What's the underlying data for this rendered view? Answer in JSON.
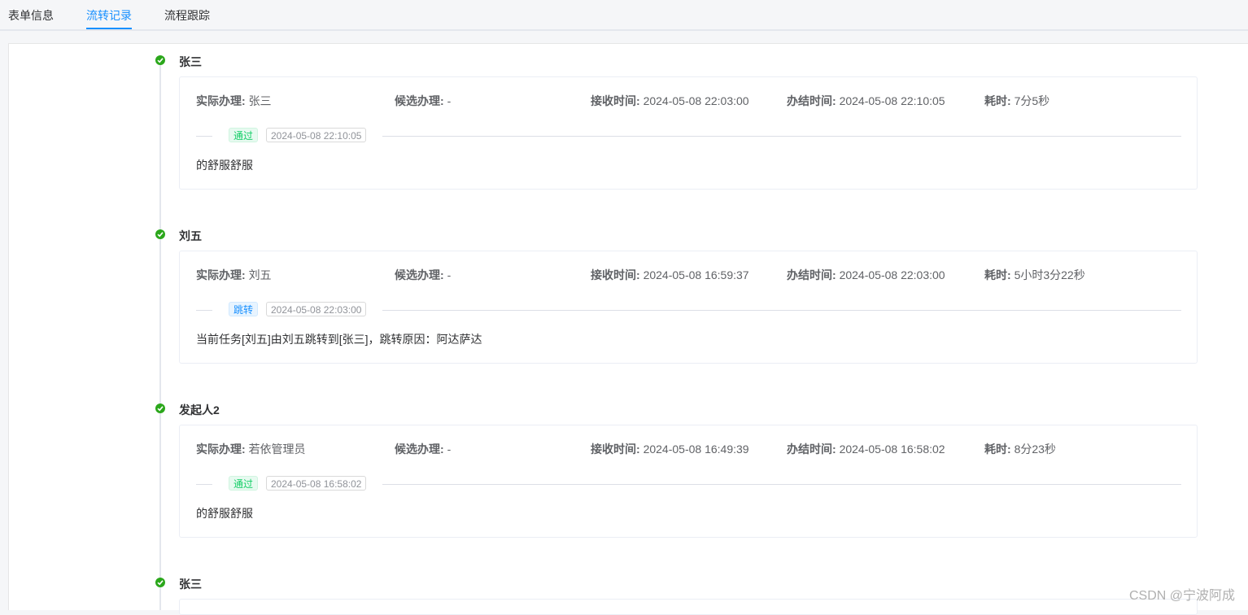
{
  "tabs": [
    {
      "label": "表单信息"
    },
    {
      "label": "流转记录"
    },
    {
      "label": "流程跟踪"
    }
  ],
  "field_labels": {
    "actual": "实际办理:",
    "candidate": "候选办理:",
    "received": "接收时间:",
    "finished": "办结时间:",
    "duration": "耗时:"
  },
  "records": [
    {
      "name": "张三",
      "actual": "张三",
      "candidate": "-",
      "received": "2024-05-08 22:03:00",
      "finished": "2024-05-08 22:10:05",
      "duration": "7分5秒",
      "status": "通过",
      "status_time": "2024-05-08 22:10:05",
      "comment": "的舒服舒服"
    },
    {
      "name": "刘五",
      "actual": "刘五",
      "candidate": "-",
      "received": "2024-05-08 16:59:37",
      "finished": "2024-05-08 22:03:00",
      "duration": "5小时3分22秒",
      "status": "跳转",
      "status_time": "2024-05-08 22:03:00",
      "comment": "当前任务[刘五]由刘五跳转到[张三]，跳转原因：阿达萨达"
    },
    {
      "name": "发起人2",
      "actual": "若依管理员",
      "candidate": "-",
      "received": "2024-05-08 16:49:39",
      "finished": "2024-05-08 16:58:02",
      "duration": "8分23秒",
      "status": "通过",
      "status_time": "2024-05-08 16:58:02",
      "comment": "的舒服舒服"
    },
    {
      "name": "张三"
    }
  ],
  "colors": {
    "accent": "#1890ff",
    "success": "#2ba71b",
    "tag_pass": "#13ce66"
  },
  "watermark": "CSDN @宁波阿成"
}
